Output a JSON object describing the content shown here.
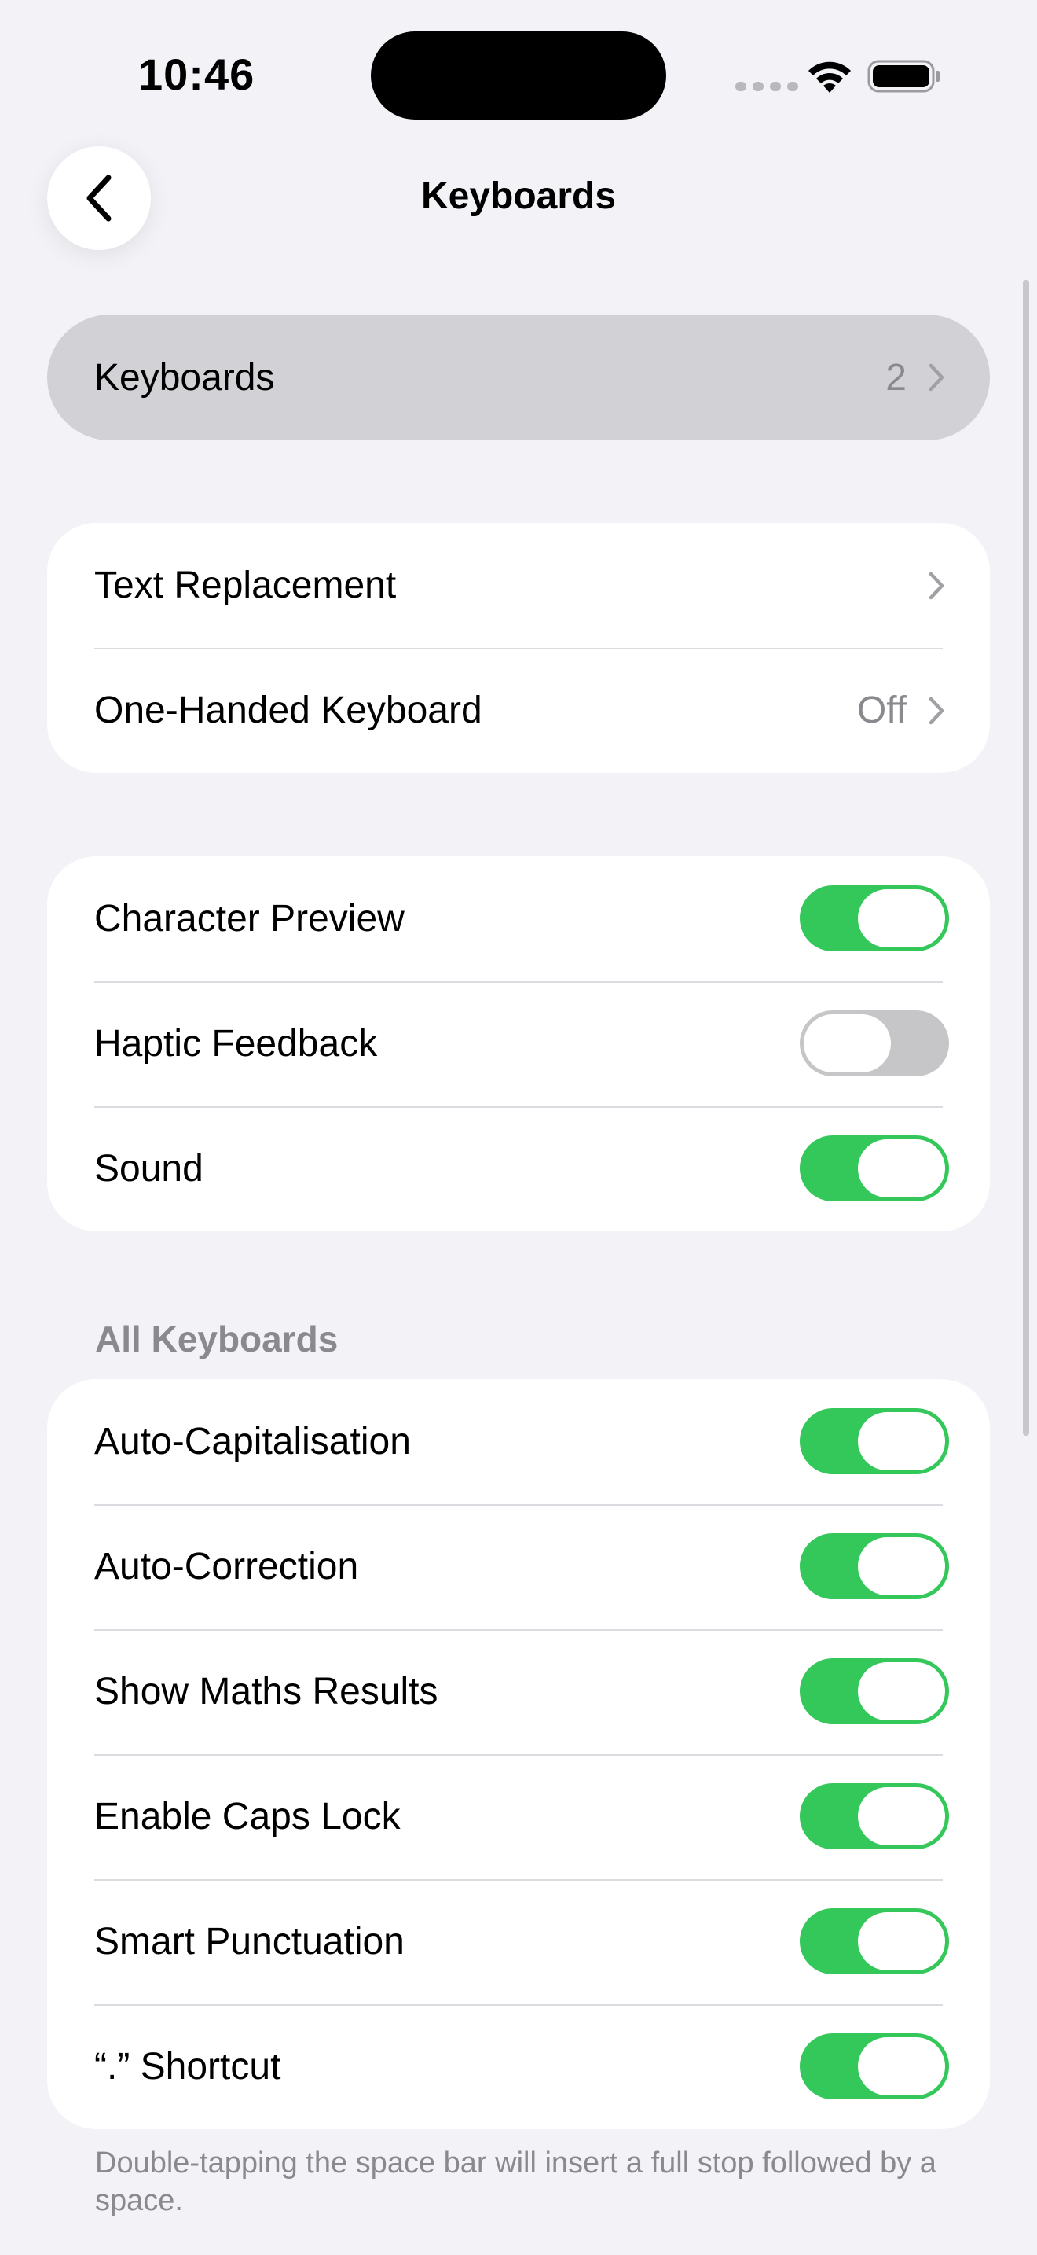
{
  "status_bar": {
    "time": "10:46",
    "icons": [
      "cellular-signal-icon",
      "wifi-icon",
      "battery-icon"
    ]
  },
  "nav": {
    "title": "Keyboards",
    "back_icon": "chevron-left-icon"
  },
  "keyboards_row": {
    "label": "Keyboards",
    "value": "2"
  },
  "group_text": {
    "items": [
      {
        "label": "Text Replacement",
        "value": ""
      },
      {
        "label": "One-Handed Keyboard",
        "value": "Off"
      }
    ]
  },
  "group_feedback": {
    "items": [
      {
        "label": "Character Preview",
        "on": true
      },
      {
        "label": "Haptic Feedback",
        "on": false
      },
      {
        "label": "Sound",
        "on": true
      }
    ]
  },
  "all_keyboards": {
    "header": "All Keyboards",
    "items": [
      {
        "label": "Auto-Capitalisation",
        "on": true
      },
      {
        "label": "Auto-Correction",
        "on": true
      },
      {
        "label": "Show Maths Results",
        "on": true
      },
      {
        "label": "Enable Caps Lock",
        "on": true
      },
      {
        "label": "Smart Punctuation",
        "on": true
      },
      {
        "label": "“.” Shortcut",
        "on": true
      }
    ],
    "footer": "Double-tapping the space bar will insert a full stop followed by a space."
  },
  "colors": {
    "background": "#f2f2f7",
    "toggle_on": "#34c759",
    "toggle_off": "#c6c6c8",
    "secondary_text": "#8a8a8e",
    "highlight_row": "#d1d1d6"
  }
}
